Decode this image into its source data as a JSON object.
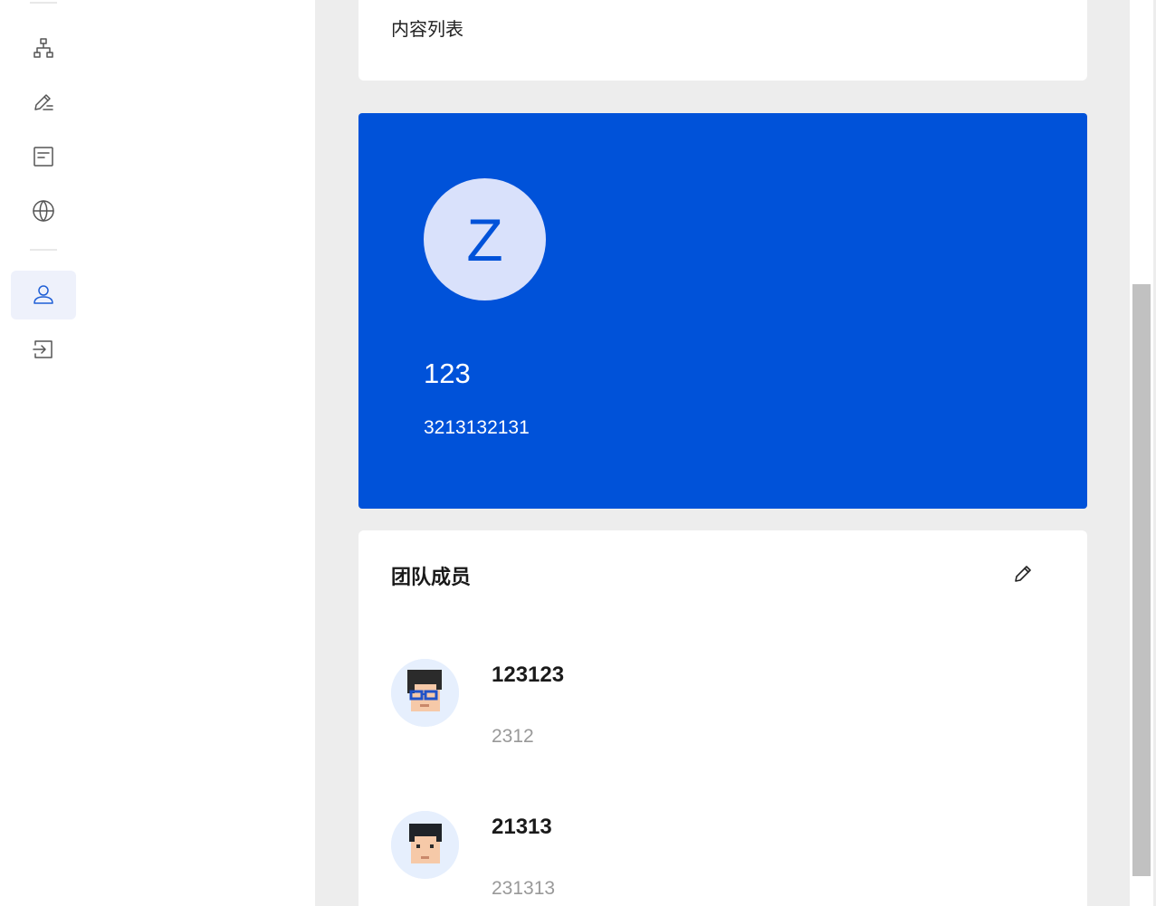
{
  "sidebar": {
    "items": [
      {
        "name": "org-structure",
        "icon": "org-tree-icon"
      },
      {
        "name": "edit",
        "icon": "pencil-lines-icon"
      },
      {
        "name": "document",
        "icon": "document-icon"
      },
      {
        "name": "globe",
        "icon": "globe-icon"
      },
      {
        "name": "user",
        "icon": "user-icon",
        "active": true
      },
      {
        "name": "logout",
        "icon": "logout-icon"
      }
    ],
    "accent": "#1f5fd6"
  },
  "top_card": {
    "label": "内容列表"
  },
  "profile": {
    "avatar_initial": "Z",
    "name": "123",
    "phone": "3213132131",
    "background": "#0052d9",
    "avatar_background": "#d9e1fb"
  },
  "team": {
    "title": "团队成员",
    "edit_icon": "edit-icon",
    "members": [
      {
        "name": "123123",
        "subtitle": "2312",
        "avatar_icon": "pixel-avatar-glasses"
      },
      {
        "name": "21313",
        "subtitle": "231313",
        "avatar_icon": "pixel-avatar"
      }
    ]
  }
}
